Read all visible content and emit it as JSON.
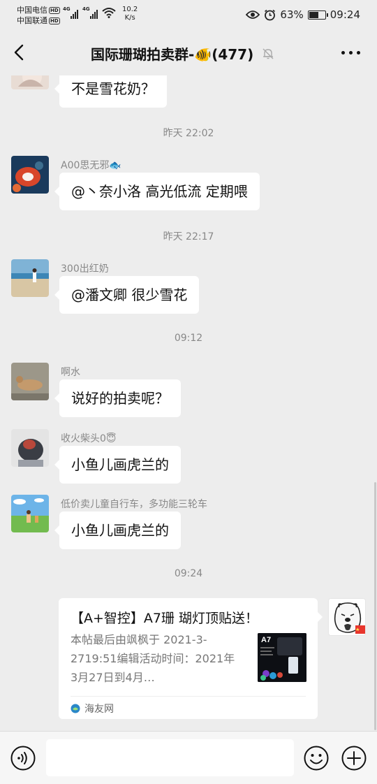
{
  "status_bar": {
    "carrier1": "中国电信",
    "carrier2": "中国联通",
    "hd_badge": "HD",
    "net_tag": "4G",
    "net_speed_value": "10.2",
    "net_speed_unit": "K/s",
    "battery_percent": "63%",
    "battery_level": 0.63,
    "time": "09:24"
  },
  "header": {
    "title": "国际珊瑚拍卖群-🐠(477)",
    "back_icon": "back-arrow-icon",
    "mute_icon": "mute-bell-icon",
    "more_icon": "more-dots-icon"
  },
  "messages": [
    {
      "type": "text",
      "sender": "",
      "text": "不是雪花奶？"
    },
    {
      "type": "time",
      "text": "昨天 22:02"
    },
    {
      "type": "text",
      "sender": "A00思无邪🐟",
      "text": "@丶奈小洛  高光低流 定期喂"
    },
    {
      "type": "time",
      "text": "昨天 22:17"
    },
    {
      "type": "text",
      "sender": "300出红奶",
      "text": "@潘文卿  很少雪花"
    },
    {
      "type": "time",
      "text": "09:12"
    },
    {
      "type": "text",
      "sender": "啊水",
      "text": "说好的拍卖呢？"
    },
    {
      "type": "text",
      "sender": "收火柴头0😇",
      "text": "小鱼儿画虎兰的"
    },
    {
      "type": "text",
      "sender": "低价卖儿童自行车，多功能三轮车",
      "text": "小鱼儿画虎兰的"
    },
    {
      "type": "time",
      "text": "09:24"
    }
  ],
  "link_card": {
    "title": "【A+智控】A7珊 瑚灯顶贴送！",
    "description": "本帖最后由飒枫于 2021-3-2719:51编辑活动时间：2021年3月27日到4月…",
    "thumb_label": "A7",
    "source": "海友网"
  },
  "input_bar": {
    "voice_icon": "voice-icon",
    "emoji_icon": "emoji-icon",
    "plus_icon": "plus-icon",
    "text_value": ""
  },
  "colors": {
    "background": "#ededed",
    "bubble": "#ffffff",
    "meta_text": "#888888",
    "flag_red": "#e8352c"
  }
}
